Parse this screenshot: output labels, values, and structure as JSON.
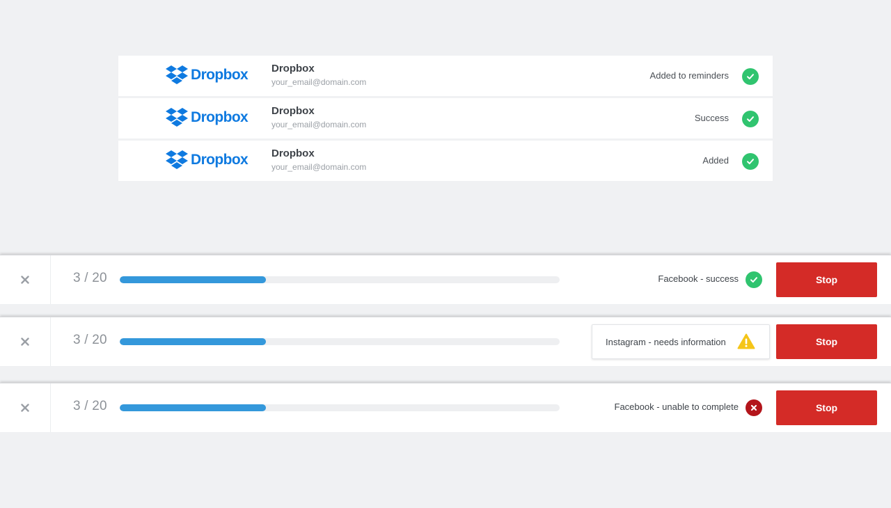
{
  "accounts": [
    {
      "brand": "Dropbox",
      "name": "Dropbox",
      "email": "your_email@domain.com",
      "status": "Added to reminders",
      "status_icon": "check-icon"
    },
    {
      "brand": "Dropbox",
      "name": "Dropbox",
      "email": "your_email@domain.com",
      "status": "Success",
      "status_icon": "check-icon"
    },
    {
      "brand": "Dropbox",
      "name": "Dropbox",
      "email": "your_email@domain.com",
      "status": "Added",
      "status_icon": "check-icon"
    }
  ],
  "tasks": [
    {
      "counter": "3 / 20",
      "progress": 0.333,
      "status": "Facebook - success",
      "status_icon": "check-icon",
      "stop_label": "Stop"
    },
    {
      "counter": "3 / 20",
      "progress": 0.333,
      "status": "Instagram - needs information",
      "status_icon": "warning-icon",
      "stop_label": "Stop"
    },
    {
      "counter": "3 / 20",
      "progress": 0.333,
      "status": "Facebook - unable to complete",
      "status_icon": "error-icon",
      "stop_label": "Stop"
    }
  ],
  "colors": {
    "brand_blue": "#0f7ae0",
    "success": "#30c46f",
    "warning": "#f5c518",
    "error": "#b3151b",
    "progress": "#3498db",
    "stop_button": "#d42b27"
  }
}
